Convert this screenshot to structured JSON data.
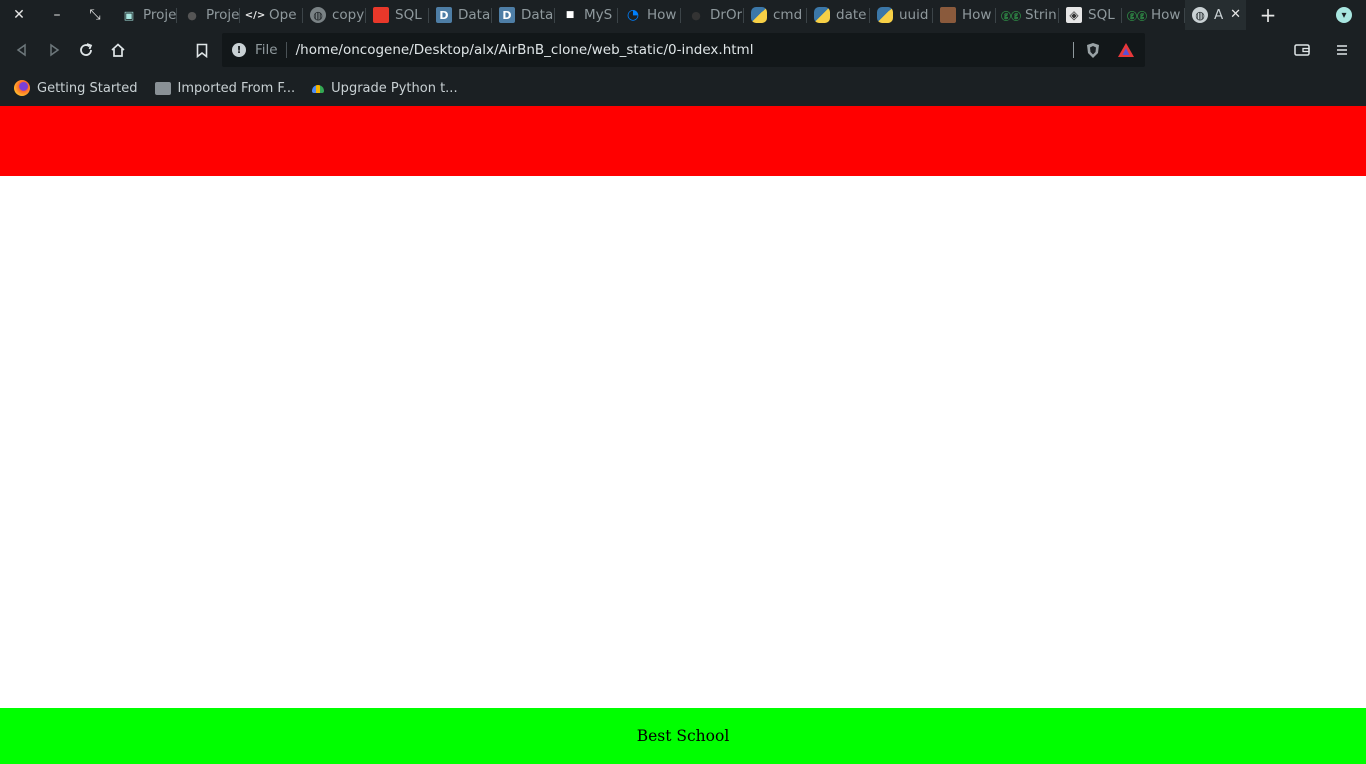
{
  "browser": {
    "tabs": [
      {
        "label": "Proje",
        "icon": "folder-icon"
      },
      {
        "label": "Proje",
        "icon": "github-icon"
      },
      {
        "label": "Ope",
        "icon": "code-icon"
      },
      {
        "label": "copy",
        "icon": "globe-icon"
      },
      {
        "label": "SQL",
        "icon": "sql-icon"
      },
      {
        "label": "Data",
        "icon": "d-icon"
      },
      {
        "label": "Data",
        "icon": "d-icon"
      },
      {
        "label": "MyS",
        "icon": "square-icon"
      },
      {
        "label": "How",
        "icon": "digitalocean-icon"
      },
      {
        "label": "DrOr",
        "icon": "circle-icon"
      },
      {
        "label": "cmd",
        "icon": "python-icon"
      },
      {
        "label": "date",
        "icon": "python-icon"
      },
      {
        "label": "uuid",
        "icon": "python-icon"
      },
      {
        "label": "How",
        "icon": "people-icon"
      },
      {
        "label": "Strin",
        "icon": "geeks-icon"
      },
      {
        "label": "SQL",
        "icon": "sql-diamond-icon"
      },
      {
        "label": "How",
        "icon": "geeks-icon"
      },
      {
        "label": "A",
        "icon": "globe-icon",
        "active": true
      }
    ],
    "address": {
      "scheme": "File",
      "url": "/home/oncogene/Desktop/alx/AirBnB_clone/web_static/0-index.html"
    },
    "bookmarks": [
      {
        "label": "Getting Started",
        "icon": "firefox-icon"
      },
      {
        "label": "Imported From F...",
        "icon": "folder-icon"
      },
      {
        "label": "Upgrade Python t...",
        "icon": "cloud-icon"
      }
    ]
  },
  "page": {
    "header_color": "#ff0000",
    "footer_color": "#00ff00",
    "footer_text": "Best School"
  }
}
